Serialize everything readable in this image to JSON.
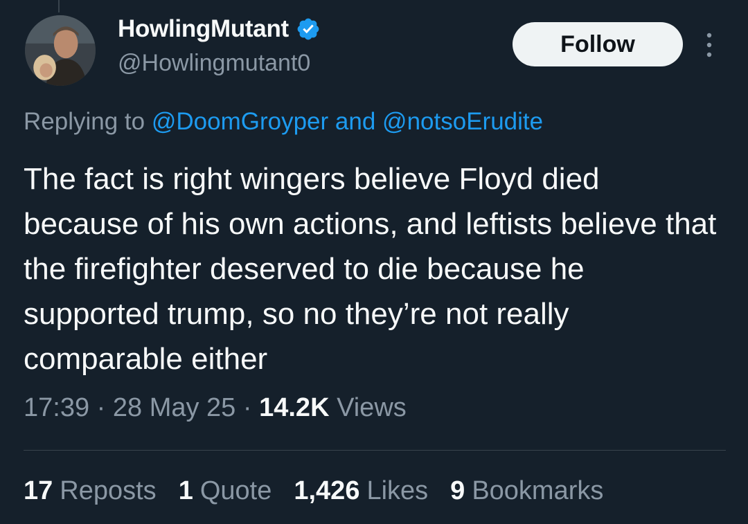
{
  "author": {
    "display_name": "HowlingMutant",
    "handle": "@Howlingmutant0",
    "verified": true,
    "avatar_icon": "profile-photo"
  },
  "header": {
    "follow_label": "Follow",
    "more_icon": "more-vertical-icon"
  },
  "reply": {
    "prefix": "Replying to",
    "mention_1": "@DoomGroyper",
    "conjunction": "and",
    "mention_2": "@notsoErudite"
  },
  "tweet": {
    "text": "The fact is right wingers believe Floyd died because of his own actions, and leftists believe that the firefighter deserved to die because he supported trump, so no they’re not really comparable either"
  },
  "meta": {
    "time": "17:39",
    "date": "28 May 25",
    "views_count": "14.2K",
    "views_label": "Views"
  },
  "stats": {
    "reposts_count": "17",
    "reposts_label": "Reposts",
    "quotes_count": "1",
    "quotes_label": "Quote",
    "likes_count": "1,426",
    "likes_label": "Likes",
    "bookmarks_count": "9",
    "bookmarks_label": "Bookmarks"
  },
  "colors": {
    "background": "#15202b",
    "text_primary": "#f7f9f9",
    "text_secondary": "#8b98a5",
    "accent": "#1d9bf0",
    "divider": "#38444d"
  }
}
